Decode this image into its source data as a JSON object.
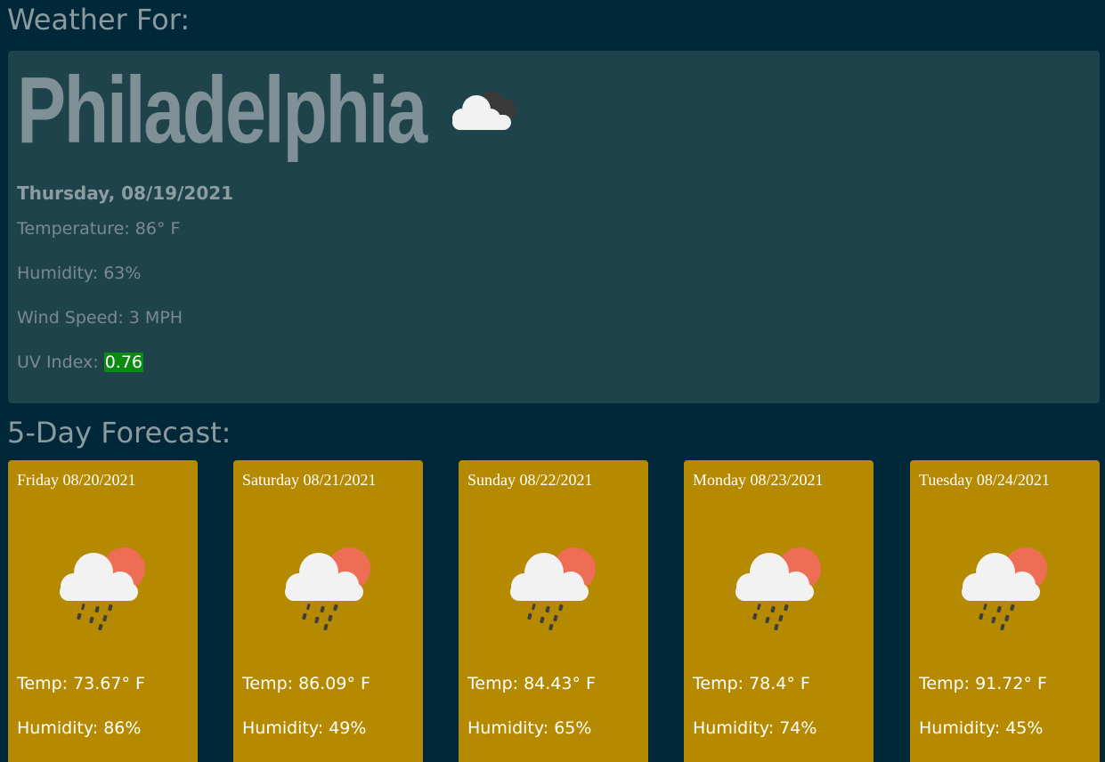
{
  "headings": {
    "weather_for": "Weather For:",
    "forecast": "5-Day Forecast:"
  },
  "current": {
    "city": "Philadelphia",
    "icon": "cloudy-icon",
    "date": "Thursday, 08/19/2021",
    "temperature_label": "Temperature: 86° F",
    "humidity_label": "Humidity: 63%",
    "wind_label": "Wind Speed: 3 MPH",
    "uv_prefix": "UV Index:",
    "uv_value": "0.76",
    "uv_color": "#0a8a10"
  },
  "forecast": [
    {
      "title": "Friday 08/20/2021",
      "icon": "rain-sun-icon",
      "temp": "Temp: 73.67° F",
      "humidity": "Humidity: 86%"
    },
    {
      "title": "Saturday 08/21/2021",
      "icon": "rain-sun-icon",
      "temp": "Temp: 86.09° F",
      "humidity": "Humidity: 49%"
    },
    {
      "title": "Sunday 08/22/2021",
      "icon": "rain-sun-icon",
      "temp": "Temp: 84.43° F",
      "humidity": "Humidity: 65%"
    },
    {
      "title": "Monday 08/23/2021",
      "icon": "rain-sun-icon",
      "temp": "Temp: 78.4° F",
      "humidity": "Humidity: 74%"
    },
    {
      "title": "Tuesday 08/24/2021",
      "icon": "rain-sun-icon",
      "temp": "Temp: 91.72° F",
      "humidity": "Humidity: 45%"
    }
  ],
  "colors": {
    "background": "#002838",
    "current_card": "#1f434b",
    "forecast_card": "#b58900",
    "sun": "#ee6e55"
  }
}
